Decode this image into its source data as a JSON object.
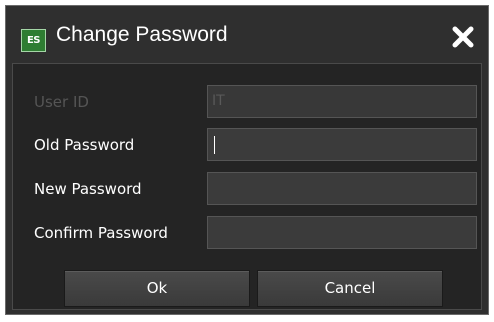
{
  "window": {
    "icon_text": "ES",
    "title": "Change Password",
    "close_icon": "close-x-icon"
  },
  "form": {
    "user_id_label": "User ID",
    "user_id_value": "IT",
    "old_password_label": "Old Password",
    "old_password_value": "",
    "new_password_label": "New Password",
    "new_password_value": "",
    "confirm_password_label": "Confirm Password",
    "confirm_password_value": ""
  },
  "buttons": {
    "ok_label": "Ok",
    "cancel_label": "Cancel"
  },
  "colors": {
    "dialog_bg": "#2f2f2f",
    "content_bg": "#242424",
    "field_bg": "#3b3b3b",
    "disabled_text": "#555555",
    "icon_green": "#2e7d32"
  }
}
